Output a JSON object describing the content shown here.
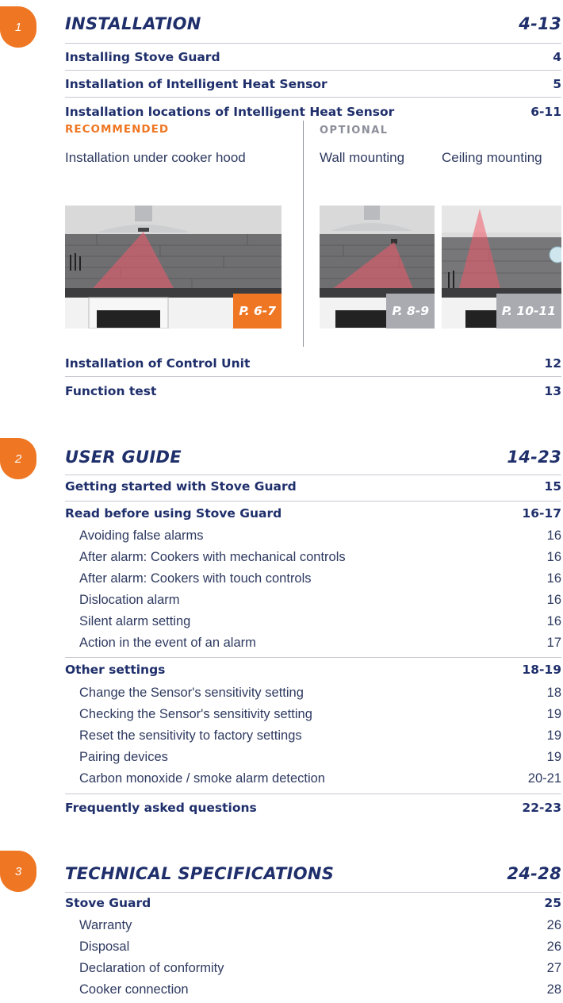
{
  "sections": [
    {
      "number": "1",
      "title": "INSTALLATION",
      "pages": "4-13",
      "entries": [
        {
          "label": "Installing Stove Guard",
          "page": "4"
        },
        {
          "label": "Installation of Intelligent Heat Sensor",
          "page": "5"
        },
        {
          "label": "Installation locations of Intelligent Heat Sensor",
          "page": "6-11"
        }
      ],
      "entries_after": [
        {
          "label": "Installation of Control Unit",
          "page": "12"
        },
        {
          "label": "Function test",
          "page": "13"
        }
      ]
    },
    {
      "number": "2",
      "title": "USER GUIDE",
      "pages": "14-23",
      "entries": [
        {
          "label": "Getting started with Stove Guard",
          "page": "15"
        },
        {
          "label": "Read before using Stove Guard",
          "page": "16-17"
        },
        {
          "label": "Avoiding false alarms",
          "page": "16"
        },
        {
          "label": "After alarm: Cookers with mechanical controls",
          "page": "16"
        },
        {
          "label": "After alarm: Cookers with touch controls",
          "page": "16"
        },
        {
          "label": "Dislocation alarm",
          "page": "16"
        },
        {
          "label": "Silent alarm setting",
          "page": "16"
        },
        {
          "label": "Action in the event of an alarm",
          "page": "17"
        },
        {
          "label": "Other settings",
          "page": "18-19"
        },
        {
          "label": "Change the Sensor's sensitivity setting",
          "page": "18"
        },
        {
          "label": "Checking the Sensor's sensitivity setting",
          "page": "19"
        },
        {
          "label": "Reset the sensitivity to factory settings",
          "page": "19"
        },
        {
          "label": "Pairing devices",
          "page": "19"
        },
        {
          "label": "Carbon monoxide / smoke alarm detection",
          "page": "20-21"
        },
        {
          "label": "Frequently asked questions",
          "page": "22-23"
        }
      ]
    },
    {
      "number": "3",
      "title": "TECHNICAL SPECIFICATIONS",
      "pages": "24-28",
      "entries": [
        {
          "label": "Stove Guard",
          "page": "25"
        },
        {
          "label": "Warranty",
          "page": "26"
        },
        {
          "label": "Disposal",
          "page": "26"
        },
        {
          "label": "Declaration of conformity",
          "page": "27"
        },
        {
          "label": "Cooker connection",
          "page": "28"
        }
      ]
    }
  ],
  "locations": {
    "recommended_label": "RECOMMENDED",
    "optional_label": "OPTIONAL",
    "under_hood": {
      "caption": "Installation under cooker hood",
      "page_tag": "P. 6-7"
    },
    "wall": {
      "caption": "Wall mounting",
      "page_tag": "P. 8-9"
    },
    "ceiling": {
      "caption": "Ceiling mounting",
      "page_tag": "P. 10-11"
    }
  },
  "colors": {
    "accent": "#ef7622",
    "navy": "#1f2f6b",
    "gray_tag": "#a9abb1"
  }
}
